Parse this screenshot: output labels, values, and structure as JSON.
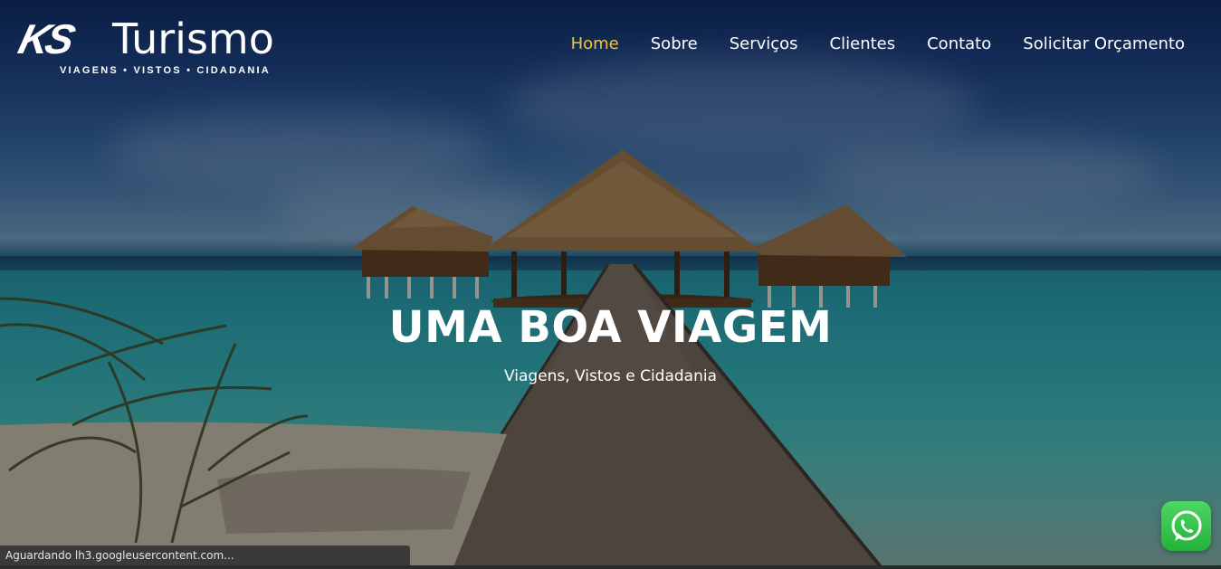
{
  "brand": {
    "logo_mark": "KS",
    "logo_name": "Turismo",
    "tagline": "VIAGENS • VISTOS • CIDADANIA"
  },
  "nav": {
    "items": [
      {
        "label": "Home",
        "active": true
      },
      {
        "label": "Sobre",
        "active": false
      },
      {
        "label": "Serviços",
        "active": false
      },
      {
        "label": "Clientes",
        "active": false
      },
      {
        "label": "Contato",
        "active": false
      },
      {
        "label": "Solicitar Orçamento",
        "active": false
      }
    ],
    "active_color": "#f4c531"
  },
  "hero": {
    "headline": "UMA BOA VIAGEM",
    "subline": "Viagens, Vistos e Cidadania"
  },
  "status_bar": {
    "text": "Aguardando lh3.googleusercontent.com..."
  },
  "whatsapp": {
    "icon": "whatsapp-icon",
    "color": "#25d366"
  }
}
